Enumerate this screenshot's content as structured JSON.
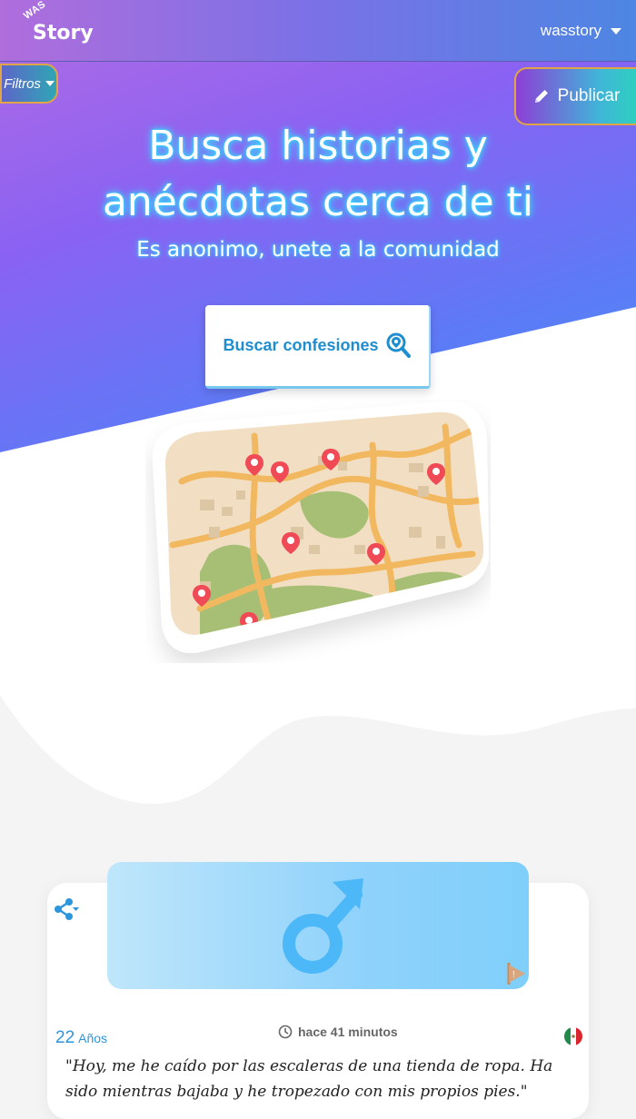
{
  "navbar": {
    "logo_small": "WAS",
    "logo_main": "Story",
    "username": "wasstory",
    "user_menu_icon": "caret-down-icon"
  },
  "filters": {
    "label": "Filtros",
    "icon": "caret-down-icon"
  },
  "publish": {
    "label": "Publicar",
    "icon": "pencil-icon"
  },
  "hero": {
    "title_line1": "Busca historias y",
    "title_line2": "anécdotas cerca de ti",
    "subtitle": "Es anonimo, unete a la comunidad",
    "search_button": "Buscar confesiones",
    "search_icon": "search-location-icon"
  },
  "illustration": {
    "icon": "map-with-pins-icon"
  },
  "story_card": {
    "gender_icon": "male-symbol-icon",
    "share_icon": "share-icon",
    "report_icon": "report-flag-icon",
    "age_value": "22",
    "age_unit": "Años",
    "time_icon": "clock-icon",
    "time_ago": "hace 41 minutos",
    "country_flag_icon": "mexico-flag-icon",
    "text": "\"Hoy, me he caído por las escaleras de una tienda de ropa. Ha sido mientras bajaba y he tropezado con mis propios pies.\""
  },
  "colors": {
    "accent_blue": "#2d95db",
    "search_text": "#1f8ed0",
    "glow": "#31e0ff",
    "border_gold": "#e0a646"
  }
}
